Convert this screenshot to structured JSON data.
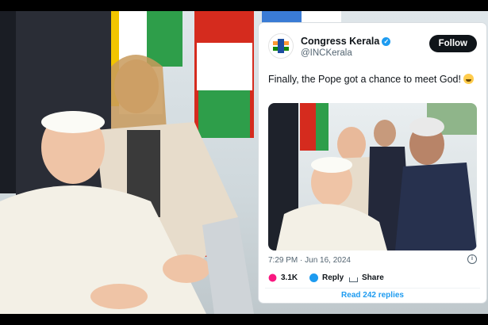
{
  "tweet": {
    "account_name": "Congress Kerala",
    "handle": "@INCKerala",
    "follow_label": "Follow",
    "text": "Finally, the Pope got a chance to meet God!",
    "emoji": "laughing-face",
    "timestamp": "7:29 PM · Jun 16, 2024",
    "likes": "3.1K",
    "reply_label": "Reply",
    "share_label": "Share",
    "read_replies_label": "Read 242 replies"
  },
  "icons": {
    "verified": "verified-badge-icon",
    "like": "heart-icon",
    "reply": "reply-bubble-icon",
    "share": "share-icon",
    "info": "info-icon"
  },
  "colors": {
    "accent": "#1d9bf0",
    "like": "#f91880",
    "button_bg": "#0f1419",
    "flag_green": "#2e9e4a",
    "flag_red": "#d52b1e",
    "flag_yellow": "#f2c500"
  }
}
